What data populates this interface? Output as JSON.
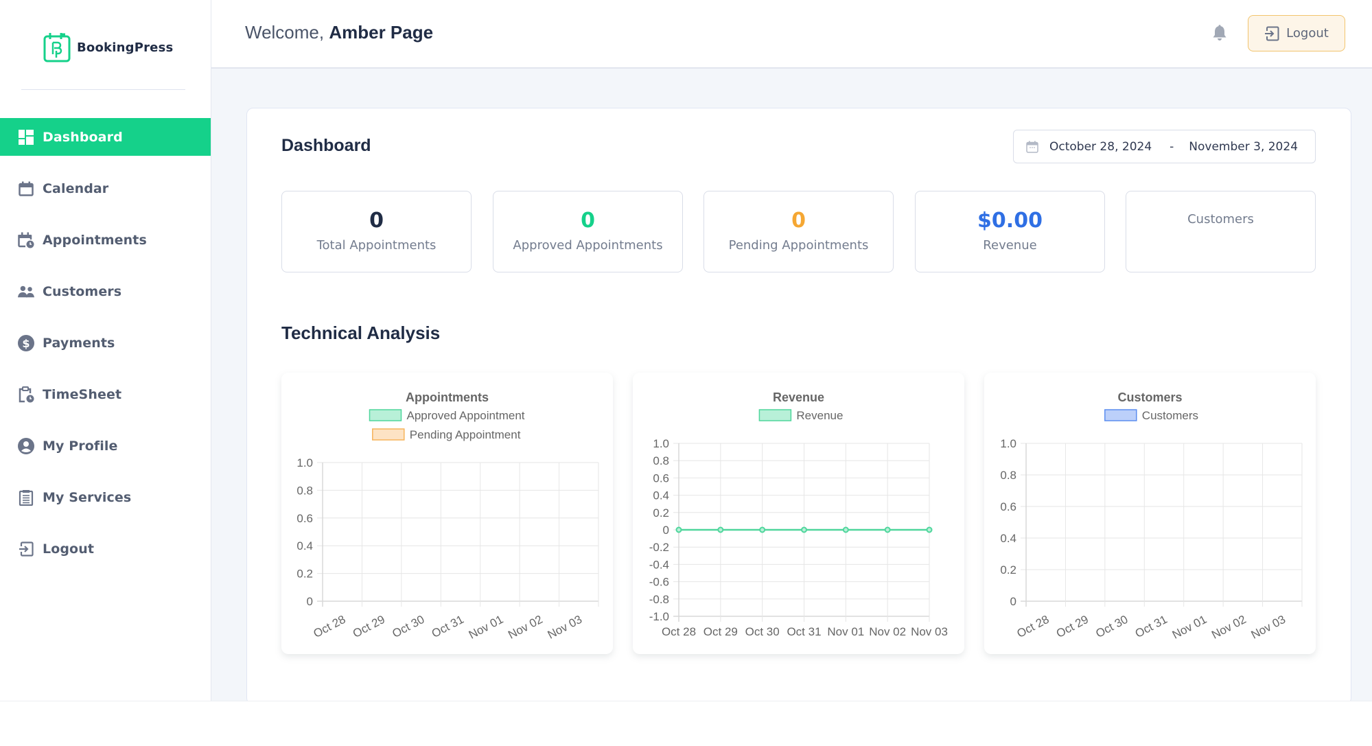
{
  "brand": {
    "name": "BookingPress",
    "accent": "#15d18a"
  },
  "sidebar": {
    "items": [
      {
        "label": "Dashboard",
        "icon": "dashboard-icon",
        "active": true
      },
      {
        "label": "Calendar",
        "icon": "calendar-icon",
        "active": false
      },
      {
        "label": "Appointments",
        "icon": "appointments-icon",
        "active": false
      },
      {
        "label": "Customers",
        "icon": "customers-icon",
        "active": false
      },
      {
        "label": "Payments",
        "icon": "payments-icon",
        "active": false
      },
      {
        "label": "TimeSheet",
        "icon": "timesheet-icon",
        "active": false
      },
      {
        "label": "My Profile",
        "icon": "profile-icon",
        "active": false
      },
      {
        "label": "My Services",
        "icon": "services-icon",
        "active": false
      },
      {
        "label": "Logout",
        "icon": "logout-icon",
        "active": false
      }
    ]
  },
  "header": {
    "welcome_prefix": "Welcome,",
    "user_name": "Amber Page",
    "logout_label": "Logout"
  },
  "dashboard": {
    "title": "Dashboard",
    "date_range": {
      "start": "October 28, 2024",
      "separator": "-",
      "end": "November 3, 2024"
    },
    "stats": [
      {
        "value": "0",
        "label": "Total Appointments",
        "color": "#202c45"
      },
      {
        "value": "0",
        "label": "Approved Appointments",
        "color": "#15d18a"
      },
      {
        "value": "0",
        "label": "Pending Appointments",
        "color": "#f5a733"
      },
      {
        "value": "$0.00",
        "label": "Revenue",
        "color": "#2f6fe4"
      },
      {
        "value": "",
        "label": "Customers",
        "color": "#202c45"
      }
    ],
    "section_title": "Technical Analysis"
  },
  "chart_data": [
    {
      "type": "bar",
      "title": "Appointments",
      "categories": [
        "Oct 28",
        "Oct 29",
        "Oct 30",
        "Oct 31",
        "Nov 01",
        "Nov 02",
        "Nov 03"
      ],
      "series": [
        {
          "name": "Approved Appointment",
          "values": [
            0,
            0,
            0,
            0,
            0,
            0,
            0
          ],
          "fill": "#b8f0d8",
          "stroke": "#4fd69c"
        },
        {
          "name": "Pending Appointment",
          "values": [
            0,
            0,
            0,
            0,
            0,
            0,
            0
          ],
          "fill": "#fde3c4",
          "stroke": "#f6b35a"
        }
      ],
      "yticks": [
        "1.0",
        "0.8",
        "0.6",
        "0.4",
        "0.2",
        "0"
      ],
      "ylim": [
        0,
        1
      ],
      "legend": "top",
      "grid": true,
      "xlabel_rotated": true
    },
    {
      "type": "line",
      "title": "Revenue",
      "categories": [
        "Oct 28",
        "Oct 29",
        "Oct 30",
        "Oct 31",
        "Nov 01",
        "Nov 02",
        "Nov 03"
      ],
      "series": [
        {
          "name": "Revenue",
          "values": [
            0,
            0,
            0,
            0,
            0,
            0,
            0
          ],
          "fill": "#b8f0d8",
          "stroke": "#4fd69c"
        }
      ],
      "yticks": [
        "1.0",
        "0.8",
        "0.6",
        "0.4",
        "0.2",
        "0",
        "-0.2",
        "-0.4",
        "-0.6",
        "-0.8",
        "-1.0"
      ],
      "ylim": [
        -1,
        1
      ],
      "legend": "top",
      "grid": true,
      "xlabel_rotated": false
    },
    {
      "type": "bar",
      "title": "Customers",
      "categories": [
        "Oct 28",
        "Oct 29",
        "Oct 30",
        "Oct 31",
        "Nov 01",
        "Nov 02",
        "Nov 03"
      ],
      "series": [
        {
          "name": "Customers",
          "values": [
            0,
            0,
            0,
            0,
            0,
            0,
            0
          ],
          "fill": "#bcd0fa",
          "stroke": "#5b8def"
        }
      ],
      "yticks": [
        "1.0",
        "0.8",
        "0.6",
        "0.4",
        "0.2",
        "0"
      ],
      "ylim": [
        0,
        1
      ],
      "legend": "top",
      "grid": true,
      "xlabel_rotated": true
    }
  ]
}
